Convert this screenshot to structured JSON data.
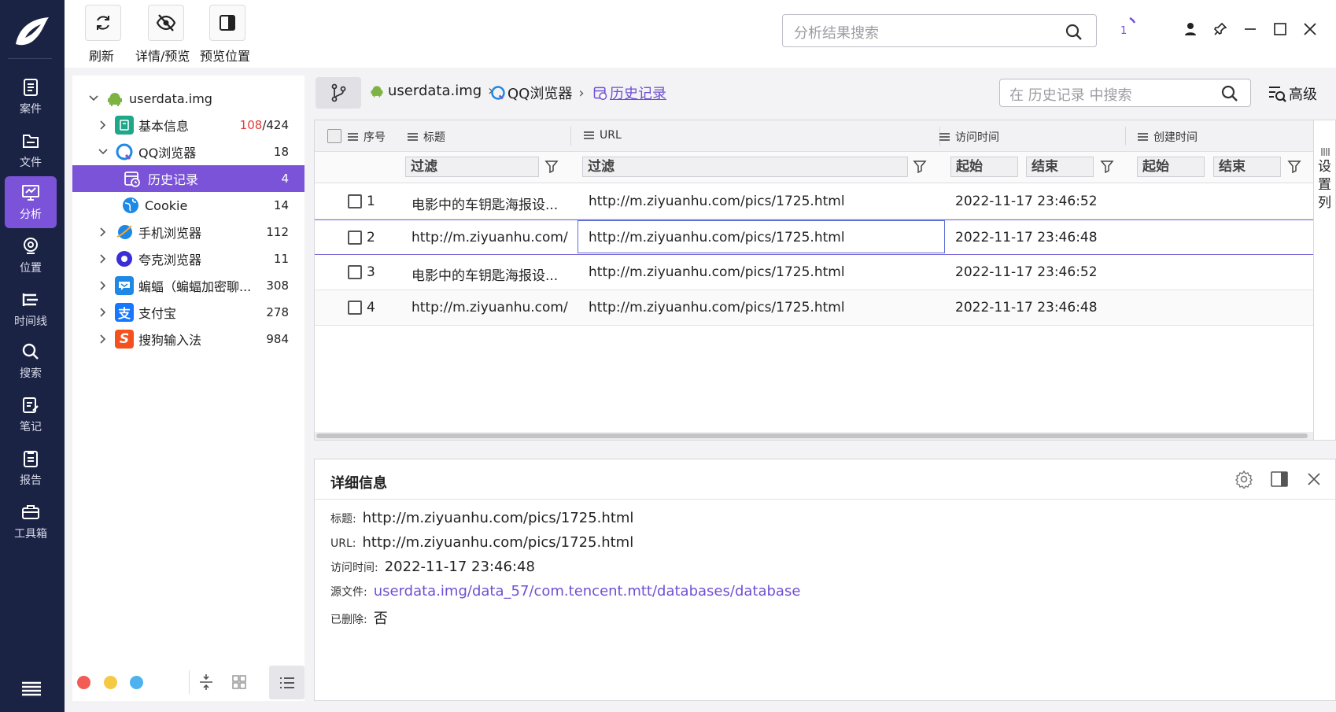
{
  "nav": {
    "items": [
      {
        "label": "案件",
        "icon": "case-icon"
      },
      {
        "label": "文件",
        "icon": "folder-icon"
      },
      {
        "label": "分析",
        "icon": "analysis-icon",
        "active": true
      },
      {
        "label": "位置",
        "icon": "location-icon"
      },
      {
        "label": "时间线",
        "icon": "timeline-icon"
      },
      {
        "label": "搜索",
        "icon": "search-icon"
      },
      {
        "label": "笔记",
        "icon": "note-icon"
      },
      {
        "label": "报告",
        "icon": "report-icon"
      },
      {
        "label": "工具箱",
        "icon": "toolbox-icon"
      }
    ]
  },
  "toolbar": {
    "refresh_label": "刷新",
    "details_label": "详情/预览",
    "preview_pos_label": "预览位置",
    "search_placeholder": "分析结果搜索",
    "task_count": "1"
  },
  "tree": {
    "root": "userdata.img",
    "items": [
      {
        "label": "基本信息",
        "count_red": "108",
        "count_rest": "/424"
      },
      {
        "label": "QQ浏览器",
        "count": "18"
      },
      {
        "label": "历史记录",
        "count": "4"
      },
      {
        "label": "Cookie",
        "count": "14"
      },
      {
        "label": "手机浏览器",
        "count": "112"
      },
      {
        "label": "夸克浏览器",
        "count": "11"
      },
      {
        "label": "蝙蝠（蝙蝠加密聊...",
        "count": "308"
      },
      {
        "label": "支付宝",
        "count": "278"
      },
      {
        "label": "搜狗输入法",
        "count": "984"
      }
    ],
    "footer_colors": [
      "#f25c54",
      "#f6c945",
      "#4db2ee"
    ]
  },
  "breadcrumb": {
    "items": [
      "userdata.img",
      "QQ浏览器",
      "历史记录"
    ],
    "search_placeholder": "在 历史记录 中搜索",
    "advanced_label": "高级"
  },
  "grid": {
    "columns": {
      "seq": "序号",
      "title": "标题",
      "url": "URL",
      "visit_time": "访问时间",
      "create_time": "创建时间"
    },
    "filters": {
      "title": "过滤",
      "url": "过滤",
      "visit_start": "起始",
      "visit_end": "结束",
      "create_start": "起始",
      "create_end": "结束"
    },
    "rows": [
      {
        "seq": "1",
        "title": "电影中的车钥匙海报设...",
        "url": "http://m.ziyuanhu.com/pics/1725.html",
        "visit_time": "2022-11-17 23:46:52",
        "create_time": ""
      },
      {
        "seq": "2",
        "title": "http://m.ziyuanhu.com/...",
        "url": "http://m.ziyuanhu.com/pics/1725.html",
        "visit_time": "2022-11-17 23:46:48",
        "create_time": ""
      },
      {
        "seq": "3",
        "title": "电影中的车钥匙海报设...",
        "url": "http://m.ziyuanhu.com/pics/1725.html",
        "visit_time": "2022-11-17 23:46:52",
        "create_time": ""
      },
      {
        "seq": "4",
        "title": "http://m.ziyuanhu.com/...",
        "url": "http://m.ziyuanhu.com/pics/1725.html",
        "visit_time": "2022-11-17 23:46:48",
        "create_time": ""
      }
    ],
    "column_settings_label": "设置列"
  },
  "detail": {
    "title": "详细信息",
    "fields": [
      {
        "label": "标题:",
        "value": "http://m.ziyuanhu.com/pics/1725.html"
      },
      {
        "label": "URL:",
        "value": "http://m.ziyuanhu.com/pics/1725.html"
      },
      {
        "label": "访问时间:",
        "value": "2022-11-17 23:46:48"
      },
      {
        "label": "源文件:",
        "value": "userdata.img/data_57/com.tencent.mtt/databases/database"
      },
      {
        "label": "已删除:",
        "value": "否"
      }
    ]
  },
  "colors": {
    "nav_bg": "#1b2344",
    "accent": "#7b53d8",
    "count_red": "#e53935",
    "link": "#6f4fd3"
  }
}
